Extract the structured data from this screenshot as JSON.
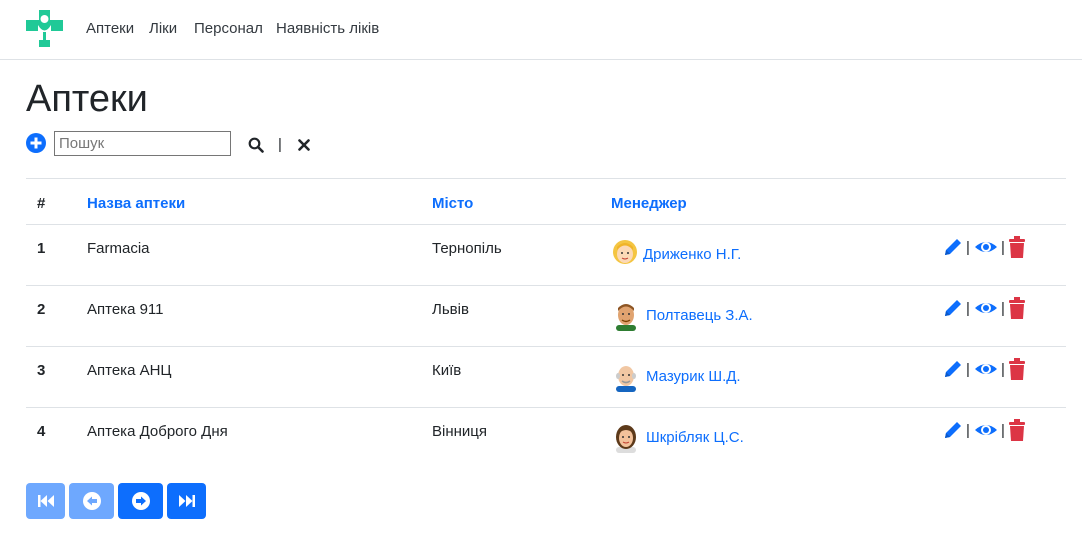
{
  "nav": {
    "items": [
      "Аптеки",
      "Ліки",
      "Персонал",
      "Наявність ліків"
    ]
  },
  "page": {
    "title": "Аптеки"
  },
  "search": {
    "placeholder": "Пошук",
    "value": "",
    "separator": "|"
  },
  "table": {
    "headers": {
      "num": "#",
      "name": "Назва аптеки",
      "city": "Місто",
      "manager": "Менеджер"
    },
    "rows": [
      {
        "num": "1",
        "name": "Farmacia",
        "city": "Тернопіль",
        "manager": "Дриженко Н.Г.",
        "avatar": "woman-blonde-avatar-icon"
      },
      {
        "num": "2",
        "name": "Аптека 911",
        "city": "Львів",
        "manager": "Полтавець З.А.",
        "avatar": "man-brown-hair-avatar-icon"
      },
      {
        "num": "3",
        "name": "Аптека АНЦ",
        "city": "Київ",
        "manager": "Мазурик Ш.Д.",
        "avatar": "old-man-bald-avatar-icon"
      },
      {
        "num": "4",
        "name": "Аптека Доброго Дня",
        "city": "Вінниця",
        "manager": "Шкрібляк Ц.С.",
        "avatar": "woman-dark-hair-avatar-icon"
      }
    ],
    "action_separator": "|"
  },
  "icons": [
    "pharmacy-cross-logo-icon",
    "plus-circle-icon",
    "search-icon",
    "close-icon",
    "pencil-icon",
    "eye-icon",
    "trash-icon",
    "first-page-icon",
    "prev-page-icon",
    "next-page-icon",
    "last-page-icon"
  ],
  "colors": {
    "accent": "#0d6efd",
    "accent_disabled": "#6ea8fe",
    "danger": "#dc3545",
    "logo_green": "#20c997"
  },
  "pagination": {
    "first_disabled": true,
    "prev_disabled": true,
    "next_disabled": false,
    "last_disabled": false
  }
}
